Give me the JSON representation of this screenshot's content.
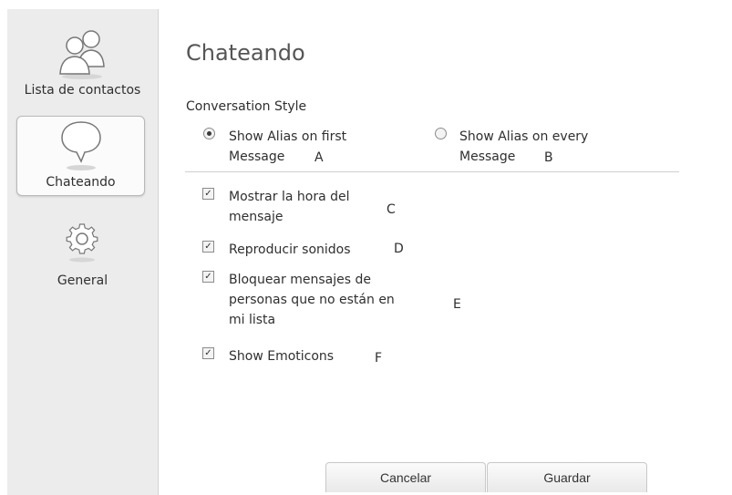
{
  "sidebar": {
    "items": [
      {
        "label": "Lista de contactos",
        "icon": "contacts-icon"
      },
      {
        "label": "Chateando",
        "icon": "chat-bubble-icon",
        "selected": true
      },
      {
        "label": "General",
        "icon": "gear-icon"
      }
    ]
  },
  "main": {
    "title": "Chateando",
    "conversation_style": {
      "heading": "Conversation Style",
      "options": [
        {
          "line1": "Show Alias on first",
          "line2": "Message",
          "marker": "A",
          "selected": true
        },
        {
          "line1": "Show Alias on every",
          "line2": "Message",
          "marker": "B",
          "selected": false
        }
      ]
    },
    "checkboxes": [
      {
        "lines": [
          "Mostrar la hora del",
          "mensaje"
        ],
        "marker": "C",
        "checked": true
      },
      {
        "lines": [
          "Reproducir sonidos"
        ],
        "marker": "D",
        "checked": true
      },
      {
        "lines": [
          "Bloquear mensajes de",
          "personas que no están en",
          "mi lista"
        ],
        "marker": "E",
        "checked": true
      },
      {
        "lines": [
          "Show Emoticons"
        ],
        "marker": "F",
        "checked": true
      }
    ]
  },
  "footer": {
    "cancel_label": "Cancelar",
    "save_label": "Guardar"
  },
  "colors": {
    "sidebar_bg": "#ececec",
    "title_text": "#555555",
    "text": "#2f2f2f"
  }
}
